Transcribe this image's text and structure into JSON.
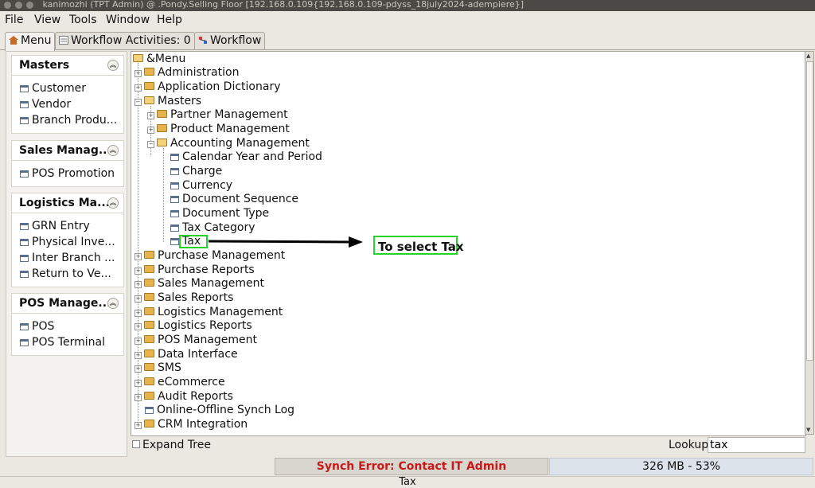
{
  "window": {
    "title": "kanimozhi (TPT Admin) @          .Pondy.Selling Floor [192.168.0.109{192.168.0.109-pdyss_18july2024-adempiere}]"
  },
  "menubar": {
    "items": [
      "File",
      "View",
      "Tools",
      "Window",
      "Help"
    ]
  },
  "tabs": {
    "menu": "Menu",
    "workflow_activities": "Workflow Activities: 0",
    "workflow": "Workflow"
  },
  "sidebar": {
    "sections": [
      {
        "title": "Masters",
        "items": [
          "Customer",
          "Vendor",
          "Branch Produ..."
        ]
      },
      {
        "title": "Sales Manag...",
        "items": [
          "POS Promotion"
        ]
      },
      {
        "title": "Logistics Ma...",
        "items": [
          "GRN Entry",
          "Physical Inve...",
          "Inter Branch ...",
          "Return to Ve..."
        ]
      },
      {
        "title": "POS Manage...",
        "items": [
          "POS",
          "POS Terminal"
        ]
      }
    ]
  },
  "tree": {
    "root": "&Menu",
    "nodes": [
      "Administration",
      "Application Dictionary",
      "Masters",
      "Partner Management",
      "Product Management",
      "Accounting Management",
      "Calendar Year and Period",
      "Charge",
      "Currency",
      "Document Sequence",
      "Document Type",
      "Tax Category",
      "Tax",
      "Purchase Management",
      "Purchase Reports",
      "Sales Management",
      "Sales Reports",
      "Logistics Management",
      "Logistics Reports",
      "POS Management",
      "Data Interface",
      "SMS",
      "eCommerce",
      "Audit Reports",
      "Online-Offline Synch Log",
      "CRM Integration"
    ]
  },
  "annotation": {
    "callout": "To select Tax",
    "color": "#27d327"
  },
  "bottom": {
    "expand_tree": "Expand Tree",
    "lookup_label": "Lookup",
    "lookup_value": "tax"
  },
  "status": {
    "synch_error": "Synch Error: Contact IT Admin",
    "memory": "326 MB - 53%",
    "footer": "Tax"
  }
}
